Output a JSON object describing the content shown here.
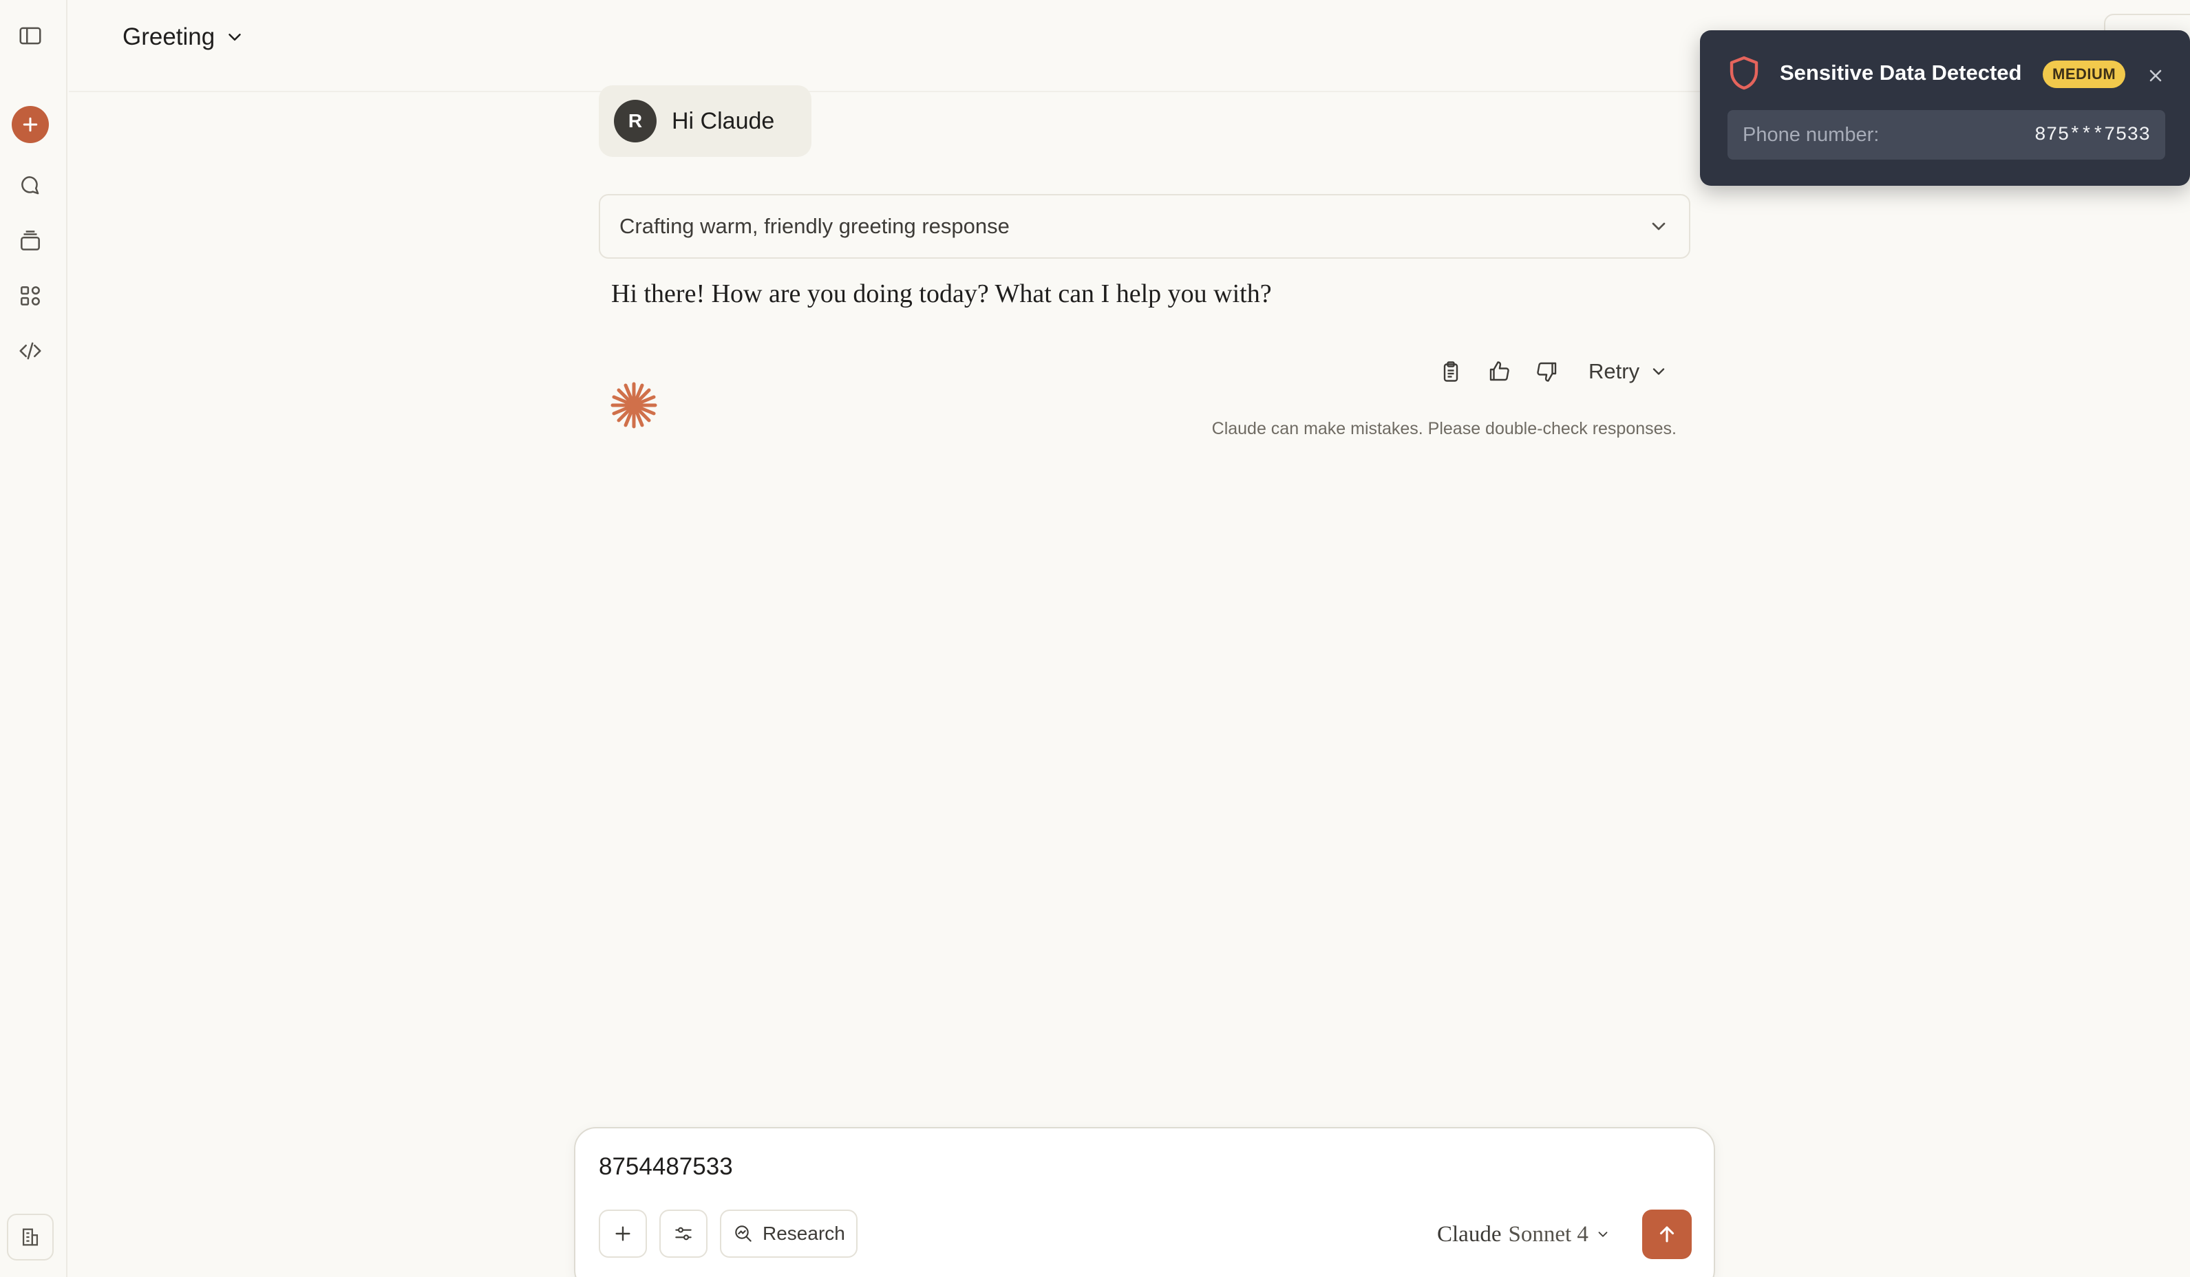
{
  "header": {
    "conversation_title": "Greeting"
  },
  "conversation": {
    "user_message": {
      "avatar_initial": "R",
      "text": "Hi Claude"
    },
    "thinking_summary": "Crafting warm, friendly greeting response",
    "assistant_response": "Hi there! How are you doing today? What can I help you with?",
    "actions": {
      "retry_label": "Retry"
    },
    "disclaimer": "Claude can make mistakes. Please double-check responses."
  },
  "composer": {
    "input_value": "8754487533",
    "research_label": "Research",
    "model_brand": "Claude",
    "model_variant": "Sonnet 4"
  },
  "alert": {
    "title": "Sensitive Data Detected",
    "severity": "MEDIUM",
    "field_label": "Phone number:",
    "field_value": "875***7533"
  },
  "colors": {
    "accent": "#c15f3c",
    "background": "#faf9f5",
    "alert_bg": "#2f3441",
    "badge": "#f2c94c",
    "shield": "#e5645c"
  },
  "icons": {
    "sidebar": [
      "sidebar-toggle-icon",
      "plus-icon",
      "chat-bubble-icon",
      "projects-icon",
      "artifacts-icon",
      "code-icon",
      "building-icon"
    ],
    "actions": [
      "copy-icon",
      "thumbs-up-icon",
      "thumbs-down-icon",
      "chevron-down-icon"
    ],
    "composer": [
      "plus-icon",
      "sliders-icon",
      "research-icon",
      "arrow-up-icon"
    ],
    "alert": [
      "shield-icon",
      "close-icon"
    ]
  }
}
